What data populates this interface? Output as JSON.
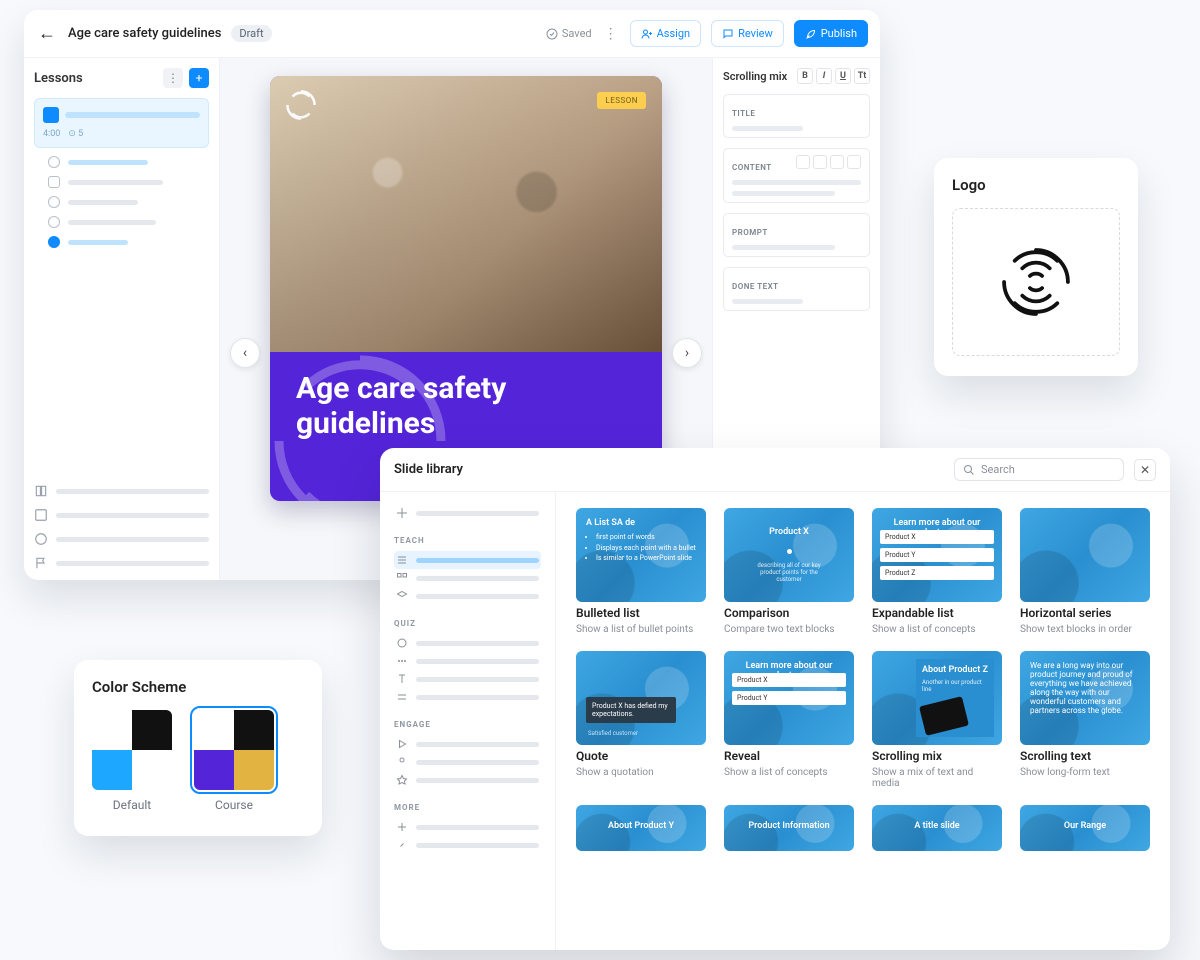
{
  "editor": {
    "title": "Age care safety guidelines",
    "status_badge": "Draft",
    "saved_label": "Saved",
    "actions": {
      "assign": "Assign",
      "review": "Review",
      "publish": "Publish"
    },
    "lessons": {
      "heading": "Lessons",
      "card_meta_left": "4:00",
      "card_meta_right": "5"
    },
    "slide": {
      "tag": "LESSON",
      "title": "Age care safety guidelines"
    },
    "props": {
      "heading": "Scrolling mix",
      "fields": {
        "title": "TITLE",
        "content": "CONTENT",
        "prompt": "PROMPT",
        "done": "DONE TEXT"
      },
      "format": {
        "b": "B",
        "i": "I",
        "u": "U",
        "t": "Tt"
      }
    }
  },
  "logo_card": {
    "heading": "Logo"
  },
  "scheme_card": {
    "heading": "Color Scheme",
    "options": [
      {
        "label": "Default",
        "colors": [
          "#ffffff",
          "#111111",
          "#1ea7ff",
          "#ffffff"
        ]
      },
      {
        "label": "Course",
        "colors": [
          "#ffffff",
          "#111111",
          "#5424d9",
          "#e3b341"
        ]
      }
    ],
    "selected": 1
  },
  "library": {
    "heading": "Slide library",
    "search_placeholder": "Search",
    "sections": [
      "TEACH",
      "QUIZ",
      "ENGAGE",
      "MORE"
    ],
    "tiles": [
      {
        "title": "Bulleted list",
        "sub": "Show a list of bullet points",
        "thumb_title": "A List SA de",
        "bullets": [
          "first point of words",
          "Displays each point with a bullet",
          "Is similar to a PowerPoint slide"
        ]
      },
      {
        "title": "Comparison",
        "sub": "Compare two text blocks",
        "thumb_title": "Product X"
      },
      {
        "title": "Expandable list",
        "sub": "Show a list of concepts",
        "thumb_title": "Learn more about our product range",
        "cards": [
          "Product X",
          "Product Y",
          "Product Z"
        ]
      },
      {
        "title": "Horizontal series",
        "sub": "Show text blocks in order"
      },
      {
        "title": "Quote",
        "sub": "Show a quotation",
        "quote": "Product X has defied my expectations."
      },
      {
        "title": "Reveal",
        "sub": "Show a list of concepts",
        "thumb_title": "Learn more about our product range",
        "cards": [
          "Product X",
          "Product Y"
        ]
      },
      {
        "title": "Scrolling mix",
        "sub": "Show a mix of text and media",
        "thumb_title": "About Product Z"
      },
      {
        "title": "Scrolling text",
        "sub": "Show long-form text"
      },
      {
        "title": "",
        "sub": "",
        "thumb_title": "About Product Y"
      },
      {
        "title": "",
        "sub": "",
        "thumb_title": "Product Information"
      },
      {
        "title": "",
        "sub": "",
        "thumb_title": "A title slide"
      },
      {
        "title": "",
        "sub": "",
        "thumb_title": "Our Range"
      }
    ]
  }
}
